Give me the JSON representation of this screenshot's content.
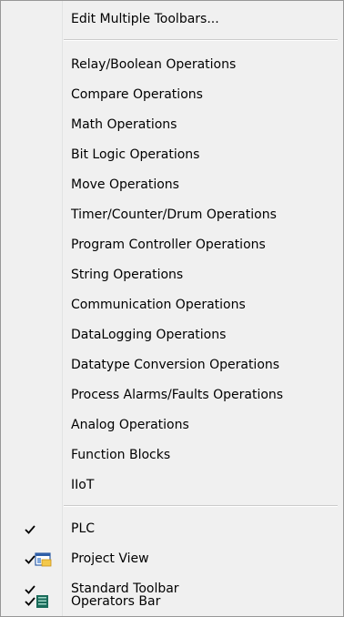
{
  "menu": {
    "edit_multiple": "Edit Multiple Toolbars...",
    "operations": [
      "Relay/Boolean Operations",
      "Compare Operations",
      "Math Operations",
      "Bit Logic Operations",
      "Move Operations",
      "Timer/Counter/Drum Operations",
      "Program Controller Operations",
      "String Operations",
      "Communication Operations",
      "DataLogging Operations",
      "Datatype Conversion Operations",
      "Process Alarms/Faults Operations",
      "Analog Operations",
      "Function Blocks",
      "IIoT"
    ],
    "views": [
      {
        "label": "PLC",
        "checked": true,
        "icon": "checkmark-icon"
      },
      {
        "label": "Project View",
        "checked": true,
        "icon": "project-view-icon"
      },
      {
        "label": "Standard Toolbar",
        "checked": true,
        "icon": "checkmark-icon"
      },
      {
        "label": "Operators Bar",
        "checked": true,
        "icon": "operators-bar-icon"
      }
    ]
  },
  "colors": {
    "menu_bg": "#f0f0f0",
    "border": "#979797",
    "separator": "#cbcbcb",
    "operators_bar_icon": "#1a6b5a",
    "project_view_icon": "#2f5fa8"
  }
}
